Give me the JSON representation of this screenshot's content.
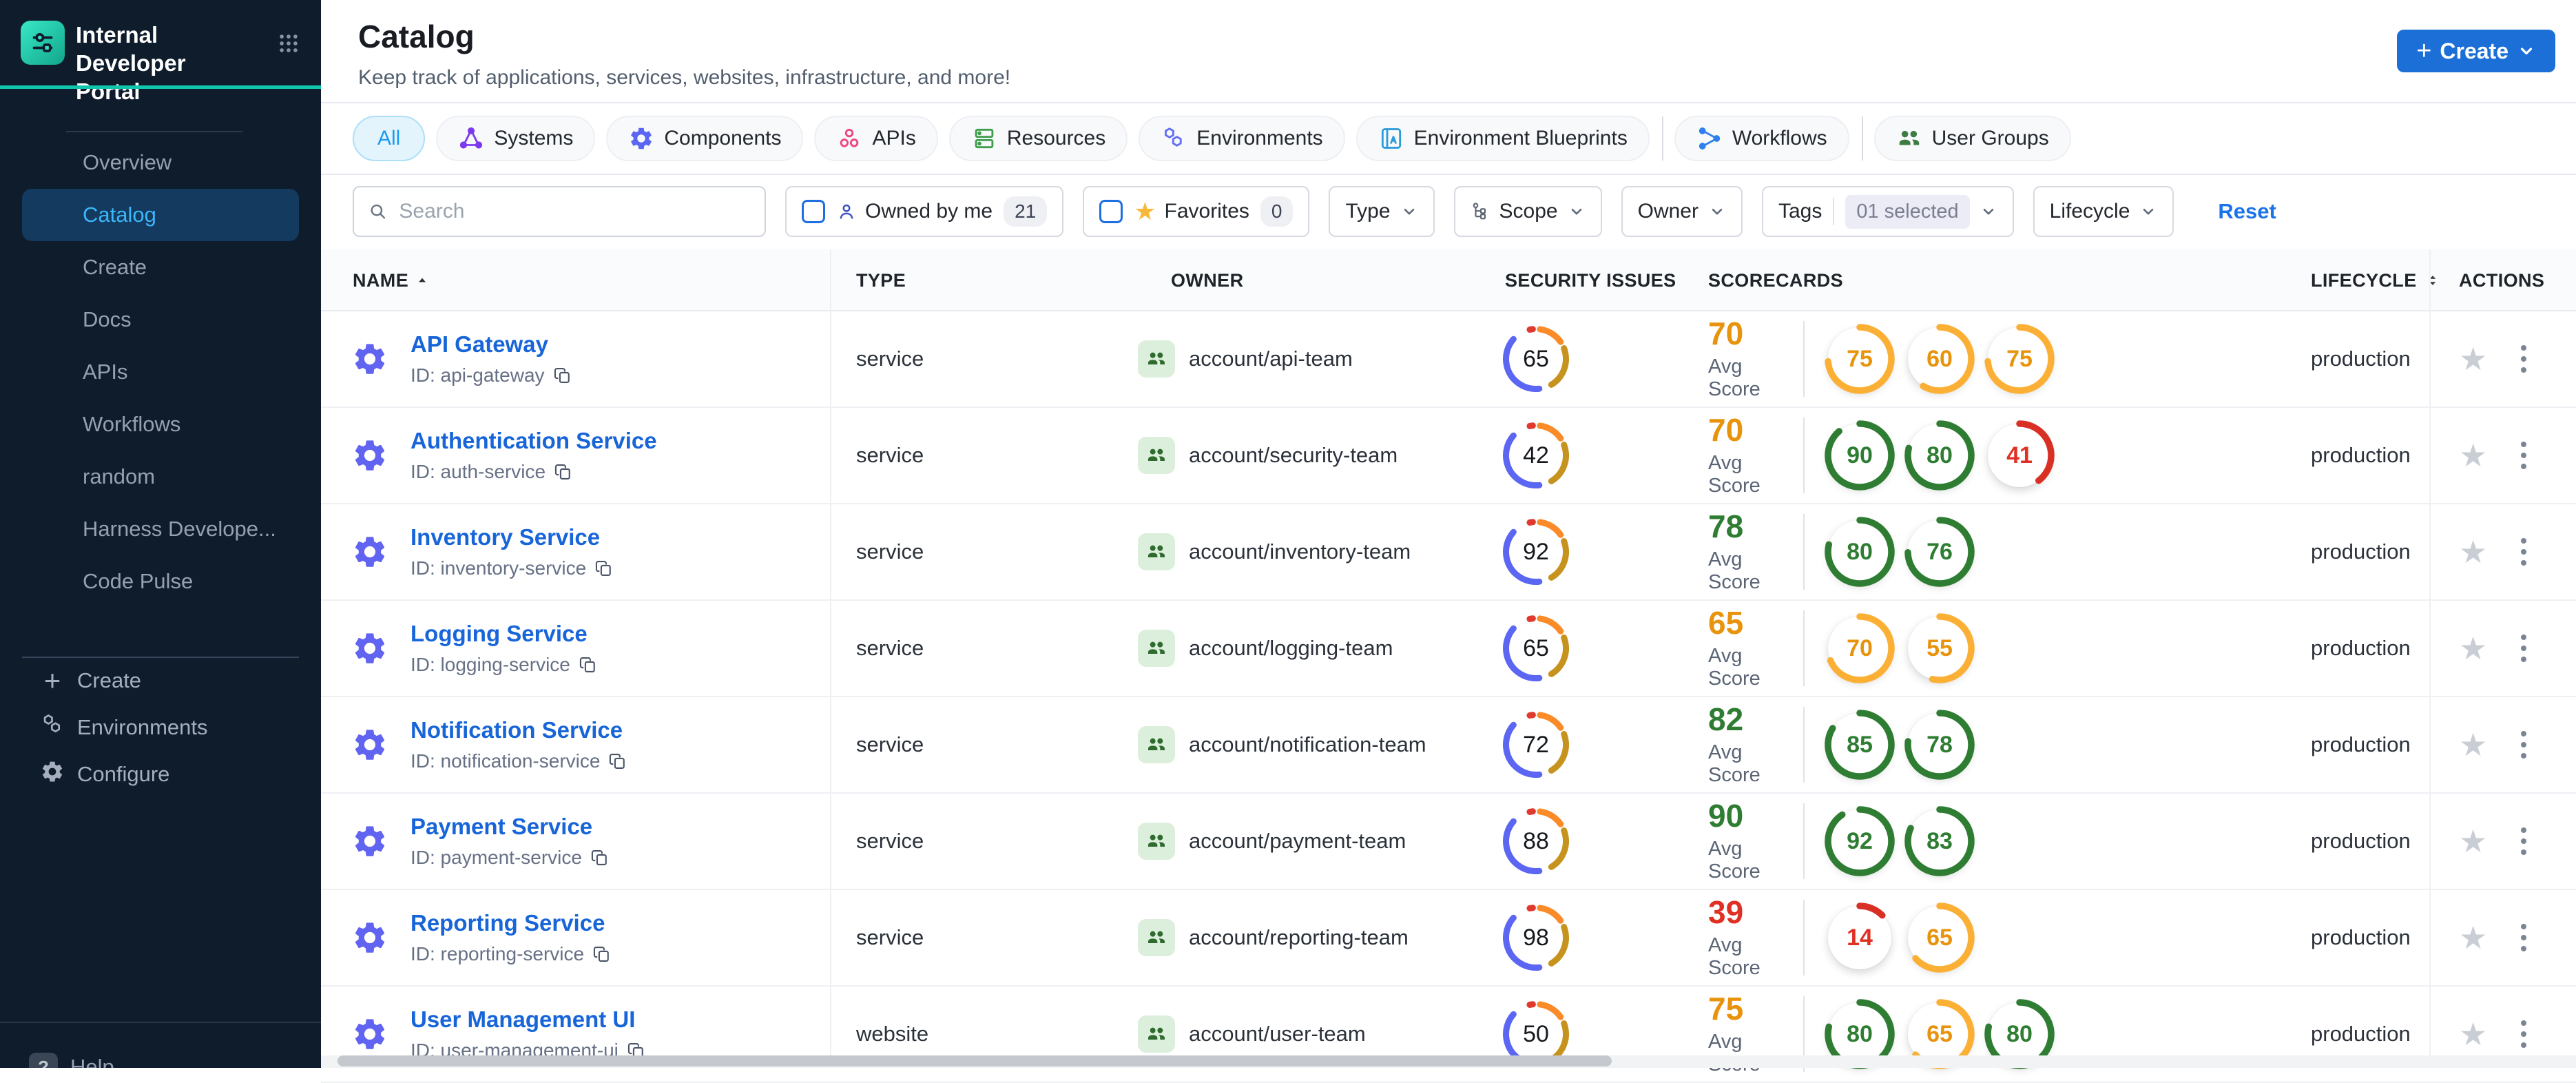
{
  "brand": {
    "title": "Internal Developer Portal"
  },
  "sidebar": {
    "items": [
      {
        "label": "Overview",
        "active": false
      },
      {
        "label": "Catalog",
        "active": true
      },
      {
        "label": "Create",
        "active": false
      },
      {
        "label": "Docs",
        "active": false
      },
      {
        "label": "APIs",
        "active": false
      },
      {
        "label": "Workflows",
        "active": false
      },
      {
        "label": "random",
        "active": false
      },
      {
        "label": "Harness Develope...",
        "active": false
      },
      {
        "label": "Code Pulse",
        "active": false
      }
    ],
    "bottom_items": [
      {
        "label": "Create",
        "icon": "plus"
      },
      {
        "label": "Environments",
        "icon": "hexagons"
      },
      {
        "label": "Configure",
        "icon": "gear"
      }
    ],
    "help_label": "Help",
    "accent_teal": "#10c6ad",
    "active_text_color": "#3ab7f8"
  },
  "header": {
    "title": "Catalog",
    "subtitle": "Keep track of applications, services, websites, infrastructure, and more!",
    "create_button": "Create",
    "create_button_color": "#1b6fd6"
  },
  "tabs": [
    {
      "label": "All",
      "active": true,
      "icon": null,
      "color": "#1a9af0"
    },
    {
      "label": "Systems",
      "icon": "network",
      "color": "#7c3aed"
    },
    {
      "label": "Components",
      "icon": "gear",
      "color": "#5b67f3"
    },
    {
      "label": "APIs",
      "icon": "api",
      "color": "#ec4580"
    },
    {
      "label": "Resources",
      "icon": "server",
      "color": "#3f9e4d"
    },
    {
      "label": "Environments",
      "icon": "hexagons",
      "color": "#6470f3"
    },
    {
      "label": "Environment Blueprints",
      "icon": "book",
      "color": "#2d9cdb"
    },
    {
      "divider": true
    },
    {
      "label": "Workflows",
      "icon": "branch",
      "color": "#2f80ed"
    },
    {
      "divider": true
    },
    {
      "label": "User Groups",
      "icon": "people",
      "color": "#3d7d44"
    }
  ],
  "filters": {
    "search_placeholder": "Search",
    "owned_by_me": {
      "label": "Owned by me",
      "count": "21"
    },
    "favorites": {
      "label": "Favorites",
      "count": "0"
    },
    "type": {
      "label": "Type"
    },
    "scope": {
      "label": "Scope"
    },
    "owner": {
      "label": "Owner"
    },
    "tags": {
      "label": "Tags",
      "value": "01 selected"
    },
    "lifecycle": {
      "label": "Lifecycle"
    },
    "reset_label": "Reset"
  },
  "table": {
    "columns": [
      "NAME",
      "TYPE",
      "OWNER",
      "SECURITY ISSUES",
      "SCORECARDS",
      "LIFECYCLE",
      "ACTIONS"
    ],
    "id_prefix": "ID: ",
    "avg_score_label": "Avg Score",
    "status_colors": {
      "green": {
        "ring": "#2e7d32",
        "text": "#2e7d32"
      },
      "orange": {
        "ring": "#fbb035",
        "text": "#e8930c"
      },
      "red": {
        "ring": "#d93025",
        "text": "#e03024"
      }
    },
    "security_segment_colors": {
      "red": "#e0392e",
      "orange": "#fb8b28",
      "amber": "#c7931f",
      "blue": "#5b66f2"
    },
    "rows": [
      {
        "name": "API Gateway",
        "id": "api-gateway",
        "type": "service",
        "owner": "account/api-team",
        "security_issues": 65,
        "avg_score": 70,
        "avg_status": "orange",
        "lifecycle": "production",
        "scorecards": [
          {
            "value": 75,
            "status": "orange"
          },
          {
            "value": 60,
            "status": "orange"
          },
          {
            "value": 75,
            "status": "orange"
          }
        ]
      },
      {
        "name": "Authentication Service",
        "id": "auth-service",
        "type": "service",
        "owner": "account/security-team",
        "security_issues": 42,
        "avg_score": 70,
        "avg_status": "orange",
        "lifecycle": "production",
        "scorecards": [
          {
            "value": 90,
            "status": "green"
          },
          {
            "value": 80,
            "status": "green"
          },
          {
            "value": 41,
            "status": "red"
          }
        ]
      },
      {
        "name": "Inventory Service",
        "id": "inventory-service",
        "type": "service",
        "owner": "account/inventory-team",
        "security_issues": 92,
        "avg_score": 78,
        "avg_status": "green",
        "lifecycle": "production",
        "scorecards": [
          {
            "value": 80,
            "status": "green"
          },
          {
            "value": 76,
            "status": "green"
          }
        ]
      },
      {
        "name": "Logging Service",
        "id": "logging-service",
        "type": "service",
        "owner": "account/logging-team",
        "security_issues": 65,
        "avg_score": 65,
        "avg_status": "orange",
        "lifecycle": "production",
        "scorecards": [
          {
            "value": 70,
            "status": "orange"
          },
          {
            "value": 55,
            "status": "orange"
          }
        ]
      },
      {
        "name": "Notification Service",
        "id": "notification-service",
        "type": "service",
        "owner": "account/notification-team",
        "security_issues": 72,
        "avg_score": 82,
        "avg_status": "green",
        "lifecycle": "production",
        "scorecards": [
          {
            "value": 85,
            "status": "green"
          },
          {
            "value": 78,
            "status": "green"
          }
        ]
      },
      {
        "name": "Payment Service",
        "id": "payment-service",
        "type": "service",
        "owner": "account/payment-team",
        "security_issues": 88,
        "avg_score": 90,
        "avg_status": "green",
        "lifecycle": "production",
        "scorecards": [
          {
            "value": 92,
            "status": "green"
          },
          {
            "value": 83,
            "status": "green"
          }
        ]
      },
      {
        "name": "Reporting Service",
        "id": "reporting-service",
        "type": "service",
        "owner": "account/reporting-team",
        "security_issues": 98,
        "avg_score": 39,
        "avg_status": "red",
        "lifecycle": "production",
        "scorecards": [
          {
            "value": 14,
            "status": "red"
          },
          {
            "value": 65,
            "status": "orange"
          }
        ]
      },
      {
        "name": "User Management UI",
        "id": "user-management-ui",
        "type": "website",
        "owner": "account/user-team",
        "security_issues": 50,
        "avg_score": 75,
        "avg_status": "orange",
        "lifecycle": "production",
        "scorecards": [
          {
            "value": 80,
            "status": "green"
          },
          {
            "value": 65,
            "status": "orange"
          },
          {
            "value": 80,
            "status": "green"
          }
        ]
      }
    ]
  }
}
